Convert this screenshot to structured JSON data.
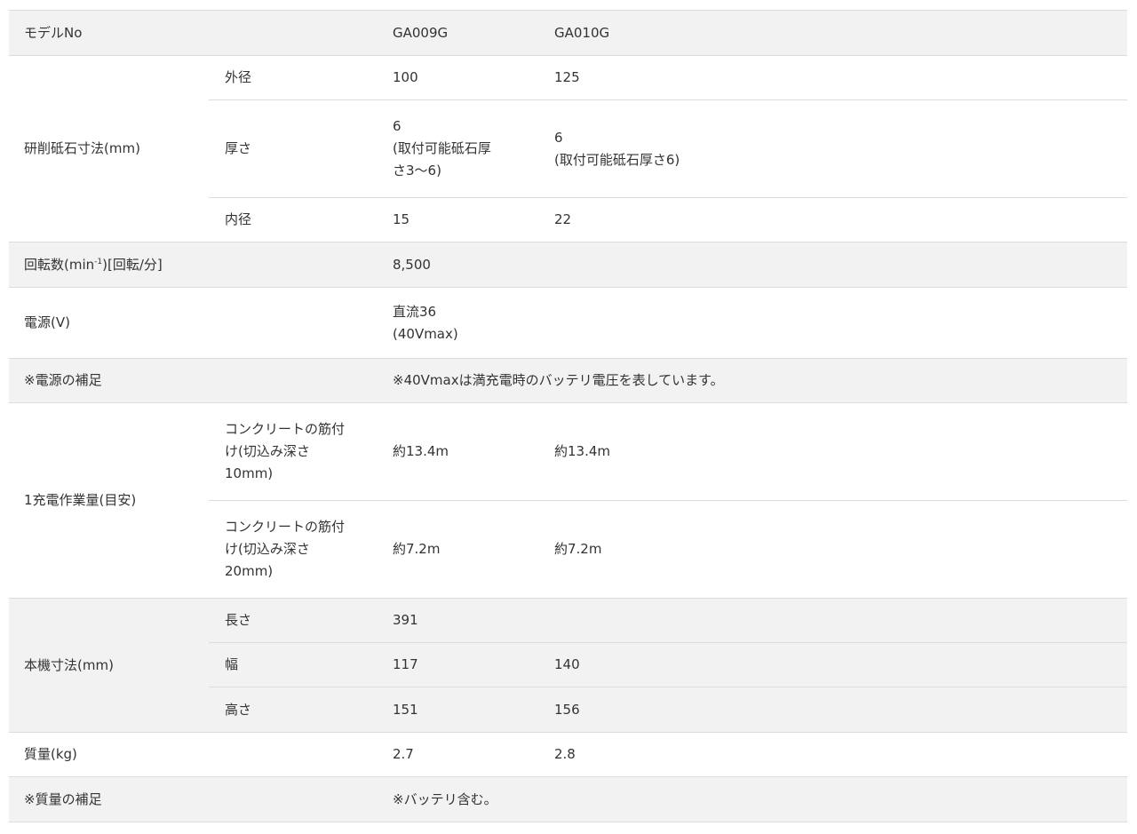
{
  "rows": {
    "model": {
      "label": "モデルNo",
      "v1": "GA009G",
      "v2": "GA010G"
    },
    "wheel": {
      "label": "研削砥石寸法(mm)",
      "outer": {
        "label": "外径",
        "v1": "100",
        "v2": "125"
      },
      "thickness": {
        "label": "厚さ",
        "v1_line1": "6",
        "v1_line2": "(取付可能砥石厚",
        "v1_line3": "さ3〜6)",
        "v2_line1": "6",
        "v2_line2": "(取付可能砥石厚さ6)"
      },
      "inner": {
        "label": "内径",
        "v1": "15",
        "v2": "22"
      }
    },
    "speed": {
      "label_pre": "回転数(min",
      "label_sup": "-1",
      "label_post": ")[回転/分]",
      "v1": "8,500"
    },
    "power": {
      "label": "電源(V)",
      "v1_line1": "直流36",
      "v1_line2": "(40Vmax)"
    },
    "power_note": {
      "label": "※電源の補足",
      "v1": "※40Vmaxは満充電時のバッテリ電圧を表しています。"
    },
    "workload": {
      "label": "1充電作業量(目安)",
      "r10": {
        "label_line1": "コンクリートの筋付",
        "label_line2": "け(切込み深さ",
        "label_line3": "10mm)",
        "v1": "約13.4m",
        "v2": "約13.4m"
      },
      "r20": {
        "label_line1": "コンクリートの筋付",
        "label_line2": "け(切込み深さ",
        "label_line3": "20mm)",
        "v1": "約7.2m",
        "v2": "約7.2m"
      }
    },
    "body": {
      "label": "本機寸法(mm)",
      "length": {
        "label": "長さ",
        "v1": "391"
      },
      "width": {
        "label": "幅",
        "v1": "117",
        "v2": "140"
      },
      "height": {
        "label": "高さ",
        "v1": "151",
        "v2": "156"
      }
    },
    "mass": {
      "label": "質量(kg)",
      "v1": "2.7",
      "v2": "2.8"
    },
    "mass_note": {
      "label": "※質量の補足",
      "v1": "※バッテリ含む。"
    }
  }
}
